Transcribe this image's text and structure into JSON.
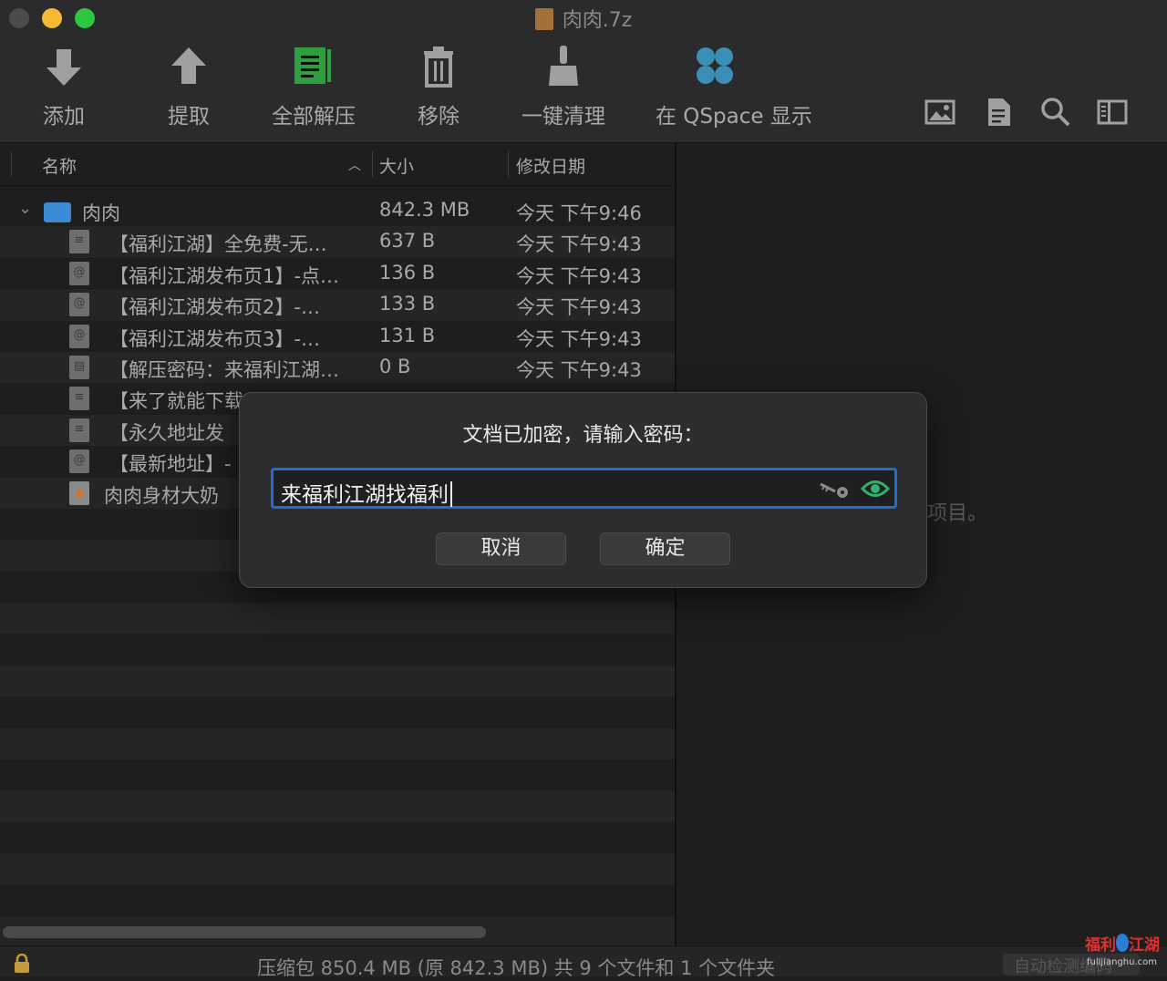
{
  "window": {
    "title": "肉肉.7z"
  },
  "toolbar": {
    "add": "添加",
    "extract": "提取",
    "extract_all": "全部解压",
    "remove": "移除",
    "clean": "一键清理",
    "qspace": "在 QSpace 显示"
  },
  "columns": {
    "name": "名称",
    "size": "大小",
    "date": "修改日期"
  },
  "folder": {
    "name": "肉肉",
    "size": "842.3 MB",
    "date": "今天 下午9:46"
  },
  "rows": [
    {
      "name": "【福利江湖】全免费-无…",
      "size": "637 B",
      "date": "今天 下午9:43",
      "icon": "text-file-icon"
    },
    {
      "name": "【福利江湖发布页1】-点…",
      "size": "136 B",
      "date": "今天 下午9:43",
      "icon": "webloc-file-icon"
    },
    {
      "name": "【福利江湖发布页2】-…",
      "size": "133 B",
      "date": "今天 下午9:43",
      "icon": "webloc-file-icon"
    },
    {
      "name": "【福利江湖发布页3】-…",
      "size": "131 B",
      "date": "今天 下午9:43",
      "icon": "webloc-file-icon"
    },
    {
      "name": "【解压密码：来福利江湖…",
      "size": "0 B",
      "date": "今天 下午9:43",
      "icon": "doc-file-icon"
    },
    {
      "name": "【来了就能下载",
      "size": "",
      "date": "",
      "icon": "text-file-icon"
    },
    {
      "name": "【永久地址发",
      "size": "",
      "date": "",
      "icon": "text-file-icon"
    },
    {
      "name": "【最新地址】-",
      "size": "",
      "date": "",
      "icon": "webloc-file-icon"
    },
    {
      "name": "肉肉身材大奶",
      "size": "",
      "date": "",
      "icon": "video-file-icon"
    }
  ],
  "right_pane": {
    "message": "项目。"
  },
  "status": {
    "text": "压缩包 850.4 MB (原 842.3 MB) 共 9 个文件和 1 个文件夹",
    "auto_button": "自动检测编码"
  },
  "dialog": {
    "prompt": "文档已加密，请输入密码：",
    "password_value": "来福利江湖找福利",
    "cancel": "取消",
    "ok": "确定"
  },
  "watermark": {
    "text": "福利江湖",
    "url": "fulijianghu.com"
  },
  "colors": {
    "accent": "#1f6fd0",
    "eye": "#2fb36a",
    "green_doc": "#2e9e3e",
    "qspace": "#3a8fb7"
  }
}
